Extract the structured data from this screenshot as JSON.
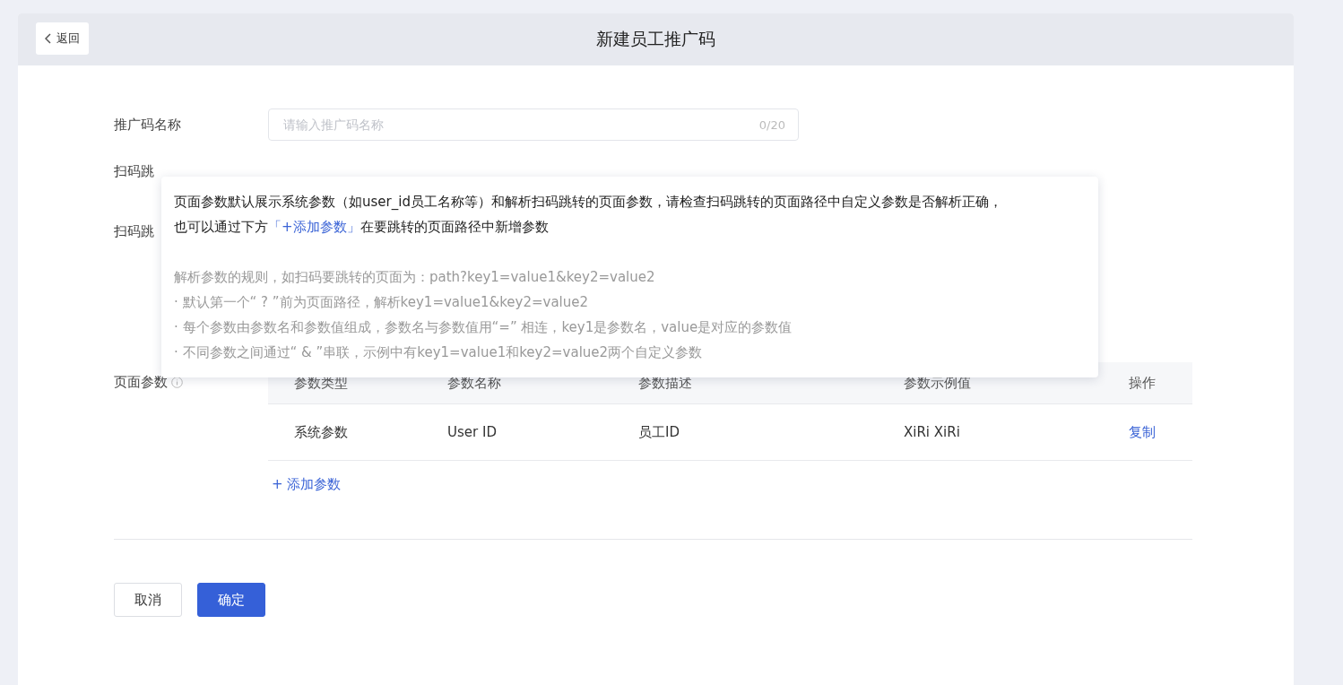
{
  "header": {
    "back_button": "返回",
    "title": "新建员工推广码"
  },
  "form": {
    "name_field": {
      "label": "推广码名称",
      "placeholder": "请输入推广码名称",
      "counter": "0/20"
    },
    "covered_labels": [
      "扫码跳",
      "扫码跳"
    ],
    "params": {
      "label": "页面参数",
      "columns": [
        "参数类型",
        "参数名称",
        "参数描述",
        "参数示例值",
        "操作"
      ],
      "rows": [
        {
          "cells": [
            "系统参数",
            "User ID",
            "员工ID",
            "XiRi XiRi"
          ],
          "action": "复制"
        }
      ],
      "add_button": "+ 添加参数"
    }
  },
  "tooltip": {
    "intro": [
      "页面参数默认展示系统参数（如user_id员工名称等）和解析扫码跳转的页面参数，请检查扫码跳转的页面路径中自定义参数是否解析正确，"
    ],
    "intro_line2": {
      "before": "也可以通过下方",
      "link": "「+添加参数」",
      "after": "在要跳转的页面路径中新增参数"
    },
    "rules_title": "解析参数的规则，如扫码要跳转的页面为：path?key1=value1&key2=value2",
    "rules": [
      "· 默认第一个“ ? ”前为页面路径，解析key1=value1&key2=value2",
      "· 每个参数由参数名和参数值组成，参数名与参数值用“=” 相连，key1是参数名，value是对应的参数值",
      "· 不同参数之间通过“ & ”串联，示例中有key1=value1和key2=value2两个自定义参数"
    ]
  },
  "footer": {
    "cancel": "取消",
    "confirm": "确定"
  }
}
